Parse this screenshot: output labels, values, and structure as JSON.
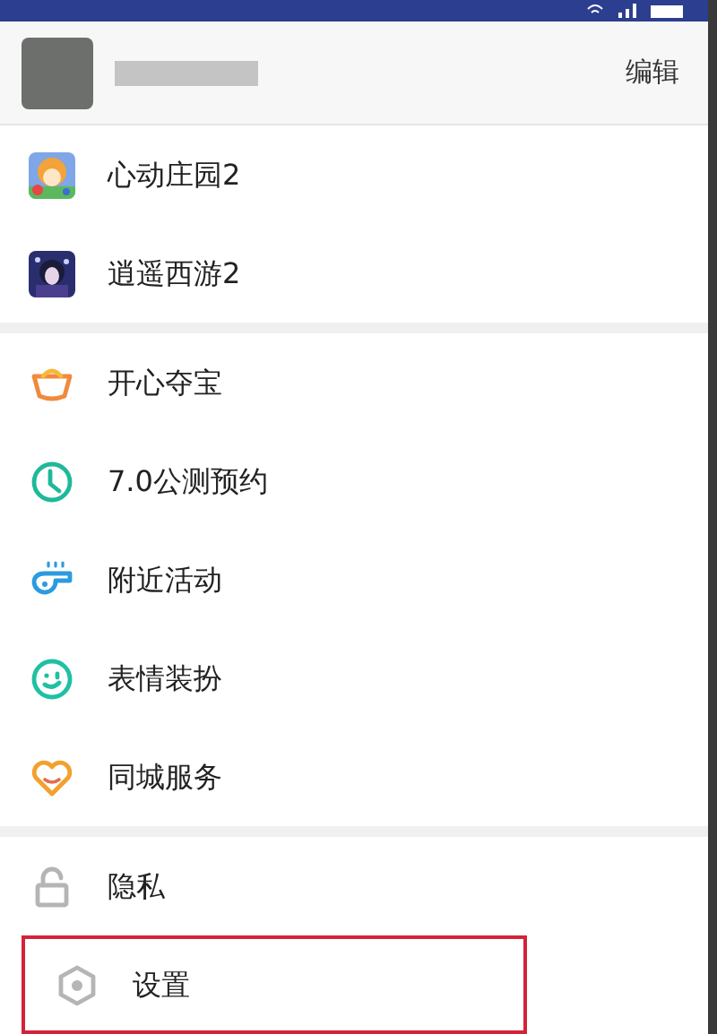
{
  "header": {
    "edit_button": "编辑"
  },
  "sections": [
    {
      "items": [
        {
          "label": "心动庄园2",
          "kind": "picture",
          "highlighted": false
        },
        {
          "label": "逍遥西游2",
          "kind": "picture",
          "highlighted": false
        }
      ]
    },
    {
      "items": [
        {
          "label": "开心夺宝",
          "kind": "ingot",
          "highlighted": false
        },
        {
          "label": "7.0公测预约",
          "kind": "clock",
          "highlighted": false
        },
        {
          "label": "附近活动",
          "kind": "whistle",
          "highlighted": false
        },
        {
          "label": "表情装扮",
          "kind": "smile",
          "highlighted": false
        },
        {
          "label": "同城服务",
          "kind": "heart",
          "highlighted": false
        }
      ]
    },
    {
      "items": [
        {
          "label": "隐私",
          "kind": "lock",
          "highlighted": false
        },
        {
          "label": "设置",
          "kind": "hexagon",
          "highlighted": true
        }
      ]
    }
  ]
}
